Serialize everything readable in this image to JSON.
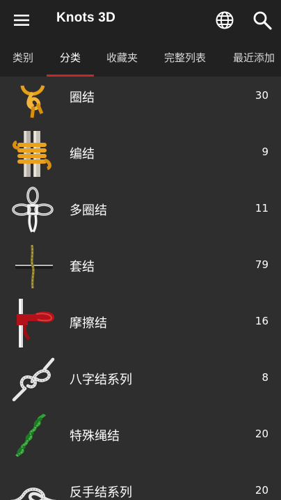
{
  "app": {
    "title": "Knots 3D",
    "accent_color": "#c62828",
    "icons": [
      "menu-icon",
      "globe-icon",
      "search-icon"
    ]
  },
  "tabs": [
    {
      "label": "类别",
      "active": false
    },
    {
      "label": "分类",
      "active": true
    },
    {
      "label": "收藏夹",
      "active": false
    },
    {
      "label": "完整列表",
      "active": false
    },
    {
      "label": "最近添加",
      "active": false
    }
  ],
  "categories": [
    {
      "label": "圈结",
      "count": "30",
      "icon": "loop-knot-icon"
    },
    {
      "label": "编结",
      "count": "9",
      "icon": "lashing-knot-icon"
    },
    {
      "label": "多圈结",
      "count": "11",
      "icon": "multi-loop-knot-icon"
    },
    {
      "label": "套结",
      "count": "79",
      "icon": "hitch-knot-icon"
    },
    {
      "label": "摩擦结",
      "count": "16",
      "icon": "friction-knot-icon"
    },
    {
      "label": "八字结系列",
      "count": "8",
      "icon": "figure-eight-knot-icon"
    },
    {
      "label": "特殊绳结",
      "count": "20",
      "icon": "special-knot-icon"
    },
    {
      "label": "反手结系列",
      "count": "20",
      "icon": "overhand-knot-icon"
    }
  ]
}
